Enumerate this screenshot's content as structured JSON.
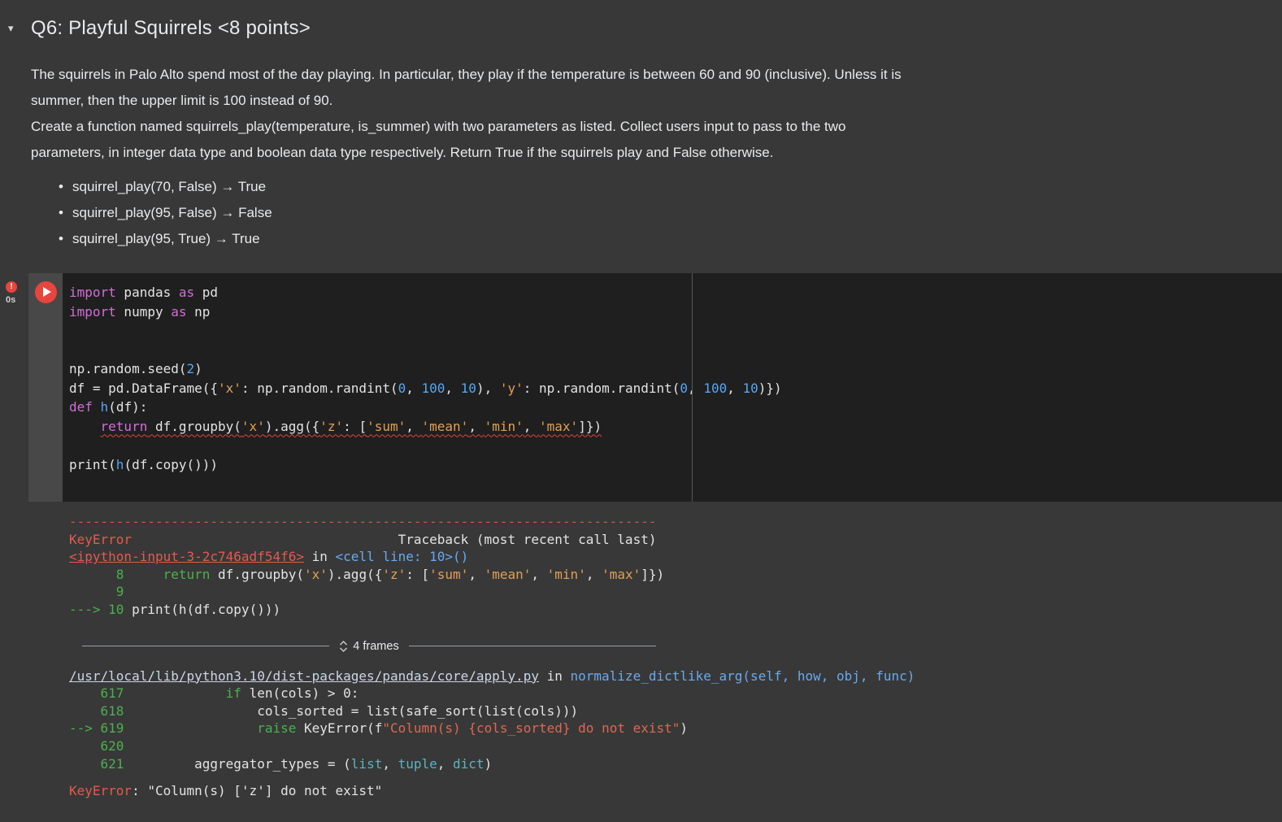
{
  "colors": {
    "page_bg": "#383838",
    "code_bg": "#1f1f1f",
    "accent_red": "#e8453c"
  },
  "markdown": {
    "collapse_icon": "▾",
    "title": "Q6: Playful Squirrels <8 points>",
    "paragraph_lines": [
      "The squirrels in Palo Alto spend most of the day playing. In particular, they play if the temperature is between 60 and 90 (inclusive). Unless it is",
      "summer, then the upper limit is 100 instead of 90.",
      "Create a function named squirrels_play(temperature, is_summer) with two parameters as listed. Collect users input to pass to the two",
      "parameters, in integer data type and boolean data type respectively. Return True if the squirrels play and False otherwise."
    ],
    "bullets": [
      "squirrel_play(70, False) → True",
      "squirrel_play(95, False) → False",
      "squirrel_play(95, True) → True"
    ]
  },
  "cell": {
    "error_badge": "!",
    "exec_time": "0s",
    "code_lines": [
      [
        [
          "k",
          "import"
        ],
        [
          "p",
          " pandas "
        ],
        [
          "k",
          "as"
        ],
        [
          "p",
          " pd"
        ]
      ],
      [
        [
          "k",
          "import"
        ],
        [
          "p",
          " numpy "
        ],
        [
          "k",
          "as"
        ],
        [
          "p",
          " np"
        ]
      ],
      [],
      [],
      [
        [
          "p",
          "np.random.seed("
        ],
        [
          "n",
          "2"
        ],
        [
          "p",
          ")"
        ]
      ],
      [
        [
          "p",
          "df = pd.DataFrame({"
        ],
        [
          "s",
          "'x'"
        ],
        [
          "p",
          ": np.random.randint("
        ],
        [
          "n",
          "0"
        ],
        [
          "p",
          ", "
        ],
        [
          "n",
          "100"
        ],
        [
          "p",
          ", "
        ],
        [
          "n",
          "10"
        ],
        [
          "p",
          "), "
        ],
        [
          "s",
          "'y'"
        ],
        [
          "p",
          ": np.random.randint("
        ],
        [
          "n",
          "0"
        ],
        [
          "p",
          ", "
        ],
        [
          "n",
          "100"
        ],
        [
          "p",
          ", "
        ],
        [
          "n",
          "10"
        ],
        [
          "p",
          ")})"
        ]
      ],
      [
        [
          "k",
          "def"
        ],
        [
          "p",
          " "
        ],
        [
          "f",
          "h"
        ],
        [
          "p",
          "(df):"
        ]
      ],
      [
        [
          "p",
          "    "
        ],
        [
          "k sq",
          "return"
        ],
        [
          "p sq",
          " df.groupby("
        ],
        [
          "s sq",
          "'x'"
        ],
        [
          "p sq",
          ").agg({"
        ],
        [
          "s sq",
          "'z'"
        ],
        [
          "p sq",
          ": ["
        ],
        [
          "s sq",
          "'sum'"
        ],
        [
          "p sq",
          ", "
        ],
        [
          "s sq",
          "'mean'"
        ],
        [
          "p sq",
          ", "
        ],
        [
          "s sq",
          "'min'"
        ],
        [
          "p sq",
          ", "
        ],
        [
          "s sq",
          "'max'"
        ],
        [
          "p sq",
          "]})"
        ]
      ],
      [],
      [
        [
          "p",
          "print("
        ],
        [
          "f",
          "h"
        ],
        [
          "p",
          "(df.copy()))"
        ]
      ]
    ]
  },
  "output": {
    "frames_label": "4 frames",
    "lines": [
      {
        "t": "code",
        "tokens": [
          [
            "d",
            "---------------------------------------------------------------------------"
          ]
        ]
      },
      {
        "t": "code",
        "tokens": [
          [
            "r",
            "KeyError"
          ],
          [
            "p",
            "                                  Traceback (most recent call last)"
          ]
        ]
      },
      {
        "t": "code",
        "tokens": [
          [
            "lr",
            "<ipython-input-3-2c746adf54f6>"
          ],
          [
            "p",
            " in "
          ],
          [
            "b",
            "<cell line: 10>()"
          ]
        ]
      },
      {
        "t": "code",
        "tokens": [
          [
            "g",
            "      8"
          ],
          [
            "p",
            "     "
          ],
          [
            "g",
            "return"
          ],
          [
            "p",
            " df.groupby("
          ],
          [
            "s",
            "'x'"
          ],
          [
            "p",
            ").agg({"
          ],
          [
            "s",
            "'z'"
          ],
          [
            "p",
            ": ["
          ],
          [
            "s",
            "'sum'"
          ],
          [
            "p",
            ", "
          ],
          [
            "s",
            "'mean'"
          ],
          [
            "p",
            ", "
          ],
          [
            "s",
            "'min'"
          ],
          [
            "p",
            ", "
          ],
          [
            "s",
            "'max'"
          ],
          [
            "p",
            "]})"
          ]
        ]
      },
      {
        "t": "code",
        "tokens": [
          [
            "g",
            "      9"
          ]
        ]
      },
      {
        "t": "code",
        "tokens": [
          [
            "g",
            "---> 10"
          ],
          [
            "p",
            " print(h(df.copy()))"
          ]
        ]
      },
      {
        "t": "frames"
      },
      {
        "t": "code",
        "tokens": [
          [
            "lb",
            "/usr/local/lib/python3.10/dist-packages/pandas/core/apply.py"
          ],
          [
            "p",
            " in "
          ],
          [
            "b",
            "normalize_dictlike_arg(self, how, obj, func)"
          ]
        ]
      },
      {
        "t": "code",
        "tokens": [
          [
            "g",
            "    617"
          ],
          [
            "p",
            "             "
          ],
          [
            "g",
            "if"
          ],
          [
            "p",
            " len(cols) > 0:"
          ]
        ]
      },
      {
        "t": "code",
        "tokens": [
          [
            "g",
            "    618"
          ],
          [
            "p",
            "                 cols_sorted = list(safe_sort(list(cols)))"
          ]
        ]
      },
      {
        "t": "code",
        "tokens": [
          [
            "g",
            "--> 619"
          ],
          [
            "p",
            "                 "
          ],
          [
            "g",
            "raise"
          ],
          [
            "p",
            " KeyError(f"
          ],
          [
            "er",
            "\"Column(s) {cols_sorted} do not exist\""
          ],
          [
            "p",
            ")"
          ]
        ]
      },
      {
        "t": "code",
        "tokens": [
          [
            "g",
            "    620"
          ]
        ]
      },
      {
        "t": "code",
        "tokens": [
          [
            "g",
            "    621"
          ],
          [
            "p",
            "         aggregator_types = ("
          ],
          [
            "b2",
            "list"
          ],
          [
            "p",
            ", "
          ],
          [
            "b2",
            "tuple"
          ],
          [
            "p",
            ", "
          ],
          [
            "b2",
            "dict"
          ],
          [
            "p",
            ")"
          ]
        ]
      },
      {
        "t": "gap"
      },
      {
        "t": "code",
        "tokens": [
          [
            "r",
            "KeyError"
          ],
          [
            "p",
            ": \"Column(s) ['z'] do not exist\""
          ]
        ]
      }
    ]
  }
}
